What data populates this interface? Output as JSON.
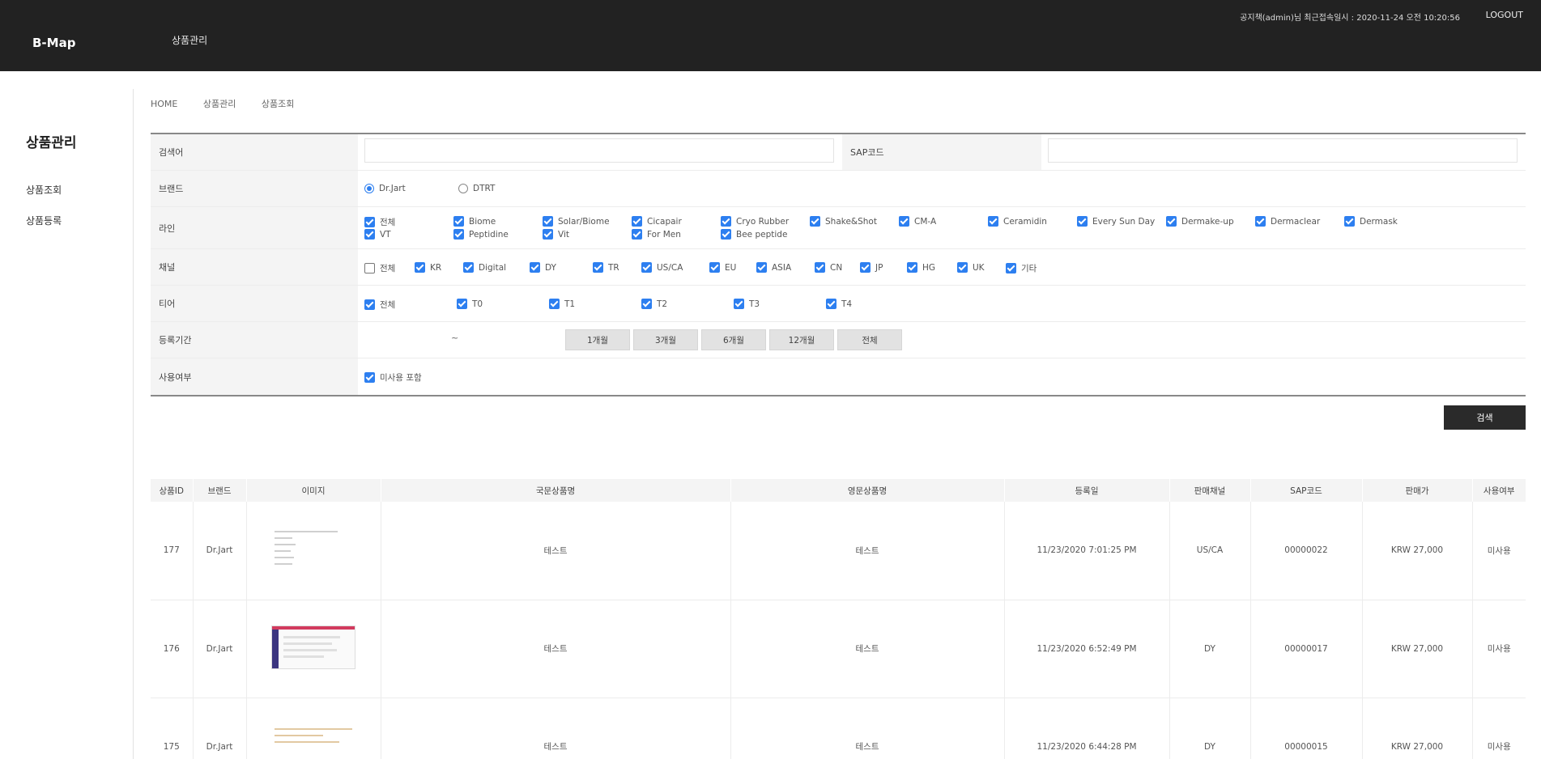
{
  "header": {
    "brand": "B-Map",
    "nav_item": "상품관리",
    "user_info": "공지책(admin)님 최근접속일시 : 2020-11-24 오전 10:20:56",
    "logout": "LOGOUT"
  },
  "sidebar": {
    "title": "상품관리",
    "items": [
      "상품조회",
      "상품등록"
    ]
  },
  "breadcrumb": [
    "HOME",
    "상품관리",
    "상품조회"
  ],
  "search": {
    "keyword_label": "검색어",
    "keyword_value": "",
    "sap_label": "SAP코드",
    "sap_value": "",
    "brand_label": "브랜드",
    "brand_options": [
      {
        "label": "Dr.Jart",
        "selected": true
      },
      {
        "label": "DTRT",
        "selected": false
      }
    ],
    "line_label": "라인",
    "line_options": [
      [
        "전체",
        "Biome",
        "Solar/Biome",
        "Cicapair",
        "Cryo Rubber",
        "Shake&Shot",
        "CM-A",
        "Ceramidin",
        "Every Sun Day",
        "Dermake-up",
        "Dermaclear",
        "Dermask"
      ],
      [
        "VT",
        "Peptidine",
        "Vit",
        "For Men",
        "Bee peptide"
      ]
    ],
    "channel_label": "채널",
    "channel_options": [
      {
        "label": "전체",
        "checked": false
      },
      {
        "label": "KR",
        "checked": true
      },
      {
        "label": "Digital",
        "checked": true
      },
      {
        "label": "DY",
        "checked": true
      },
      {
        "label": "TR",
        "checked": true
      },
      {
        "label": "US/CA",
        "checked": true
      },
      {
        "label": "EU",
        "checked": true
      },
      {
        "label": "ASIA",
        "checked": true
      },
      {
        "label": "CN",
        "checked": true
      },
      {
        "label": "JP",
        "checked": true
      },
      {
        "label": "HG",
        "checked": true
      },
      {
        "label": "UK",
        "checked": true
      },
      {
        "label": "기타",
        "checked": true
      }
    ],
    "tier_label": "티어",
    "tier_options": [
      "전체",
      "T0",
      "T1",
      "T2",
      "T3",
      "T4"
    ],
    "period_label": "등록기간",
    "period_separator": "~",
    "period_buttons": [
      "1개월",
      "3개월",
      "6개월",
      "12개월",
      "전체"
    ],
    "use_label": "사용여부",
    "use_option": "미사용 포함",
    "search_button": "검색"
  },
  "table": {
    "headers": [
      "상품ID",
      "브랜드",
      "이미지",
      "국문상품명",
      "영문상품명",
      "등록일",
      "판매채널",
      "SAP코드",
      "판매가",
      "사용여부"
    ],
    "rows": [
      [
        "177",
        "Dr.Jart",
        "",
        "테스트",
        "테스트",
        "11/23/2020 7:01:25 PM",
        "US/CA",
        "00000022",
        "KRW 27,000",
        "미사용"
      ],
      [
        "176",
        "Dr.Jart",
        "",
        "테스트",
        "테스트",
        "11/23/2020 6:52:49 PM",
        "DY",
        "00000017",
        "KRW 27,000",
        "미사용"
      ],
      [
        "175",
        "Dr.Jart",
        "",
        "테스트",
        "테스트",
        "11/23/2020 6:44:28 PM",
        "DY",
        "00000015",
        "KRW 27,000",
        "미사용"
      ]
    ]
  },
  "colors": {
    "topbar": "#222222",
    "checkbox": "#2d7ff0",
    "search_button": "#2a2a2a"
  }
}
